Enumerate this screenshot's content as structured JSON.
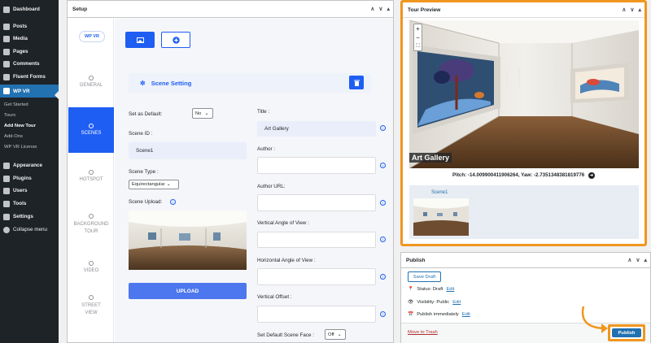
{
  "sidebar": {
    "items_top": [
      {
        "label": "Dashboard",
        "icon": "dashboard-icon"
      },
      {
        "label": "Posts",
        "icon": "pin-icon"
      },
      {
        "label": "Media",
        "icon": "media-icon"
      },
      {
        "label": "Pages",
        "icon": "pages-icon"
      },
      {
        "label": "Comments",
        "icon": "comments-icon"
      },
      {
        "label": "Fluent Forms",
        "icon": "forms-icon"
      },
      {
        "label": "WP VR",
        "icon": "vr-icon"
      }
    ],
    "submenu": [
      "Get Started",
      "Tours",
      "Add New Tour",
      "Add-Ons",
      "WP VR License"
    ],
    "items_bottom": [
      {
        "label": "Appearance",
        "icon": "appearance-icon"
      },
      {
        "label": "Plugins",
        "icon": "plugins-icon"
      },
      {
        "label": "Users",
        "icon": "users-icon"
      },
      {
        "label": "Tools",
        "icon": "tools-icon"
      },
      {
        "label": "Settings",
        "icon": "settings-icon"
      },
      {
        "label": "Collapse menu",
        "icon": "collapse-icon"
      }
    ]
  },
  "setup": {
    "title": "Setup",
    "logo": "WP VR",
    "vtabs": [
      {
        "label": "GENERAL"
      },
      {
        "label": "SCENES"
      },
      {
        "label": "HOTSPOT"
      },
      {
        "label": "BACKGROUND TOUR"
      },
      {
        "label": "VIDEO"
      },
      {
        "label": "STREET VIEW"
      }
    ],
    "scene_setting": "Scene Setting",
    "set_default_label": "Set as Default:",
    "set_default_value": "No",
    "scene_id_label": "Scene ID :",
    "scene_id_value": "Scene1",
    "scene_type_label": "Scene Type :",
    "scene_type_value": "Equirectangular",
    "scene_upload_label": "Scene Upload:",
    "upload_button": "UPLOAD",
    "title_label": "Title :",
    "title_value": "Art Gallery",
    "author_label": "Author :",
    "author_url_label": "Author URL:",
    "vangle_label": "Vertical Angle of View :",
    "hangle_label": "Horizontal Angle of View :",
    "voffset_label": "Vertical Offset :",
    "default_face_label": "Set Default Scene Face :",
    "default_face_value": "Off"
  },
  "preview": {
    "title": "Tour Preview",
    "scene_title": "Art Gallery",
    "pitch_yaw": "Pitch: -14.009900411906264, Yaw: -2.7351348381819776",
    "thumb_label": "Scene1"
  },
  "publish": {
    "title": "Publish",
    "save_draft": "Save Draft",
    "status_label": "Status: Draft",
    "visibility_label": "Visibility: Public",
    "schedule_label": "Publish immediately",
    "edit_link": "Edit",
    "trash_link": "Move to Trash",
    "publish_button": "Publish"
  },
  "colors": {
    "accent": "#1e5ef3",
    "highlight": "#f0961e",
    "wp_blue": "#2271b1"
  }
}
